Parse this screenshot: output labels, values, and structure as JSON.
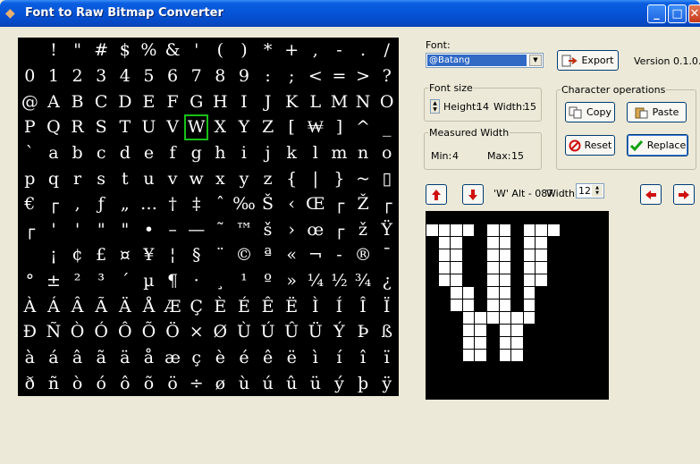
{
  "window": {
    "title": "Font to Raw Bitmap Converter"
  },
  "glyph_rows": [
    [
      " ",
      "!",
      "\"",
      "#",
      "$",
      "%",
      "&",
      "'",
      "(",
      ")",
      "*",
      "+",
      ",",
      "-",
      ".",
      "/"
    ],
    [
      "0",
      "1",
      "2",
      "3",
      "4",
      "5",
      "6",
      "7",
      "8",
      "9",
      ":",
      ";",
      "<",
      "=",
      ">",
      "?"
    ],
    [
      "@",
      "A",
      "B",
      "C",
      "D",
      "E",
      "F",
      "G",
      "H",
      "I",
      "J",
      "K",
      "L",
      "M",
      "N",
      "O"
    ],
    [
      "P",
      "Q",
      "R",
      "S",
      "T",
      "U",
      "V",
      "W",
      "X",
      "Y",
      "Z",
      "[",
      "₩",
      "]",
      "^",
      "_"
    ],
    [
      "`",
      "a",
      "b",
      "c",
      "d",
      "e",
      "f",
      "g",
      "h",
      "i",
      "j",
      "k",
      "l",
      "m",
      "n",
      "o"
    ],
    [
      "p",
      "q",
      "r",
      "s",
      "t",
      "u",
      "v",
      "w",
      "x",
      "y",
      "z",
      "{",
      "|",
      "}",
      "~",
      "▯"
    ],
    [
      "€",
      "┌",
      "‚",
      "ƒ",
      "„",
      "…",
      "†",
      "‡",
      "ˆ",
      "‰",
      "Š",
      "‹",
      "Œ",
      "┌",
      "Ž",
      "┌"
    ],
    [
      "┌",
      "'",
      "'",
      "\"",
      "\"",
      "•",
      "–",
      "—",
      "˜",
      "™",
      "š",
      "›",
      "œ",
      "┌",
      "ž",
      "Ÿ"
    ],
    [
      " ",
      "¡",
      "¢",
      "£",
      "¤",
      "¥",
      "¦",
      "§",
      "¨",
      "©",
      "ª",
      "«",
      "¬",
      "-",
      "®",
      "¯"
    ],
    [
      "°",
      "±",
      "²",
      "³",
      "´",
      "µ",
      "¶",
      "·",
      "¸",
      "¹",
      "º",
      "»",
      "¼",
      "½",
      "¾",
      "¿"
    ],
    [
      "À",
      "Á",
      "Â",
      "Ã",
      "Ä",
      "Å",
      "Æ",
      "Ç",
      "È",
      "É",
      "Ê",
      "Ë",
      "Ì",
      "Í",
      "Î",
      "Ï"
    ],
    [
      "Ð",
      "Ñ",
      "Ò",
      "Ó",
      "Ô",
      "Õ",
      "Ö",
      "×",
      "Ø",
      "Ù",
      "Ú",
      "Û",
      "Ü",
      "Ý",
      "Þ",
      "ß"
    ],
    [
      "à",
      "á",
      "â",
      "ã",
      "ä",
      "å",
      "æ",
      "ç",
      "è",
      "é",
      "ê",
      "ë",
      "ì",
      "í",
      "î",
      "ï"
    ],
    [
      "ð",
      "ñ",
      "ò",
      "ó",
      "ô",
      "õ",
      "ö",
      "÷",
      "ø",
      "ù",
      "ú",
      "û",
      "ü",
      "ý",
      "þ",
      "ÿ"
    ]
  ],
  "font": {
    "label": "Font:",
    "selected": "@Batang"
  },
  "export": {
    "label": "Export"
  },
  "version": "Version 0.1.0.0",
  "font_size": {
    "legend": "Font size",
    "height_label": "Height:",
    "height": "14",
    "width_label": "Width:",
    "width": "15"
  },
  "measured_width": {
    "legend": "Measured Width",
    "min_label": "Min:",
    "min": "4",
    "max_label": "Max:",
    "max": "15"
  },
  "char_ops": {
    "legend": "Character operations",
    "copy": "Copy",
    "paste": "Paste",
    "reset": "Reset",
    "replace": "Replace"
  },
  "char_info": {
    "text": "'W' Alt - 087",
    "width_label": "Width:",
    "width_value": "12"
  },
  "bitmap": {
    "rows": [
      "000000000000000",
      "111101101110000",
      "011001101100000",
      "011001101100000",
      "011001101100000",
      "011001101100000",
      "001101101000000",
      "001101101000000",
      "000111111000000",
      "000110110000000",
      "000110110000000",
      "000110110000000",
      "000000000000000",
      "000000000000000",
      "000000000000000"
    ]
  }
}
